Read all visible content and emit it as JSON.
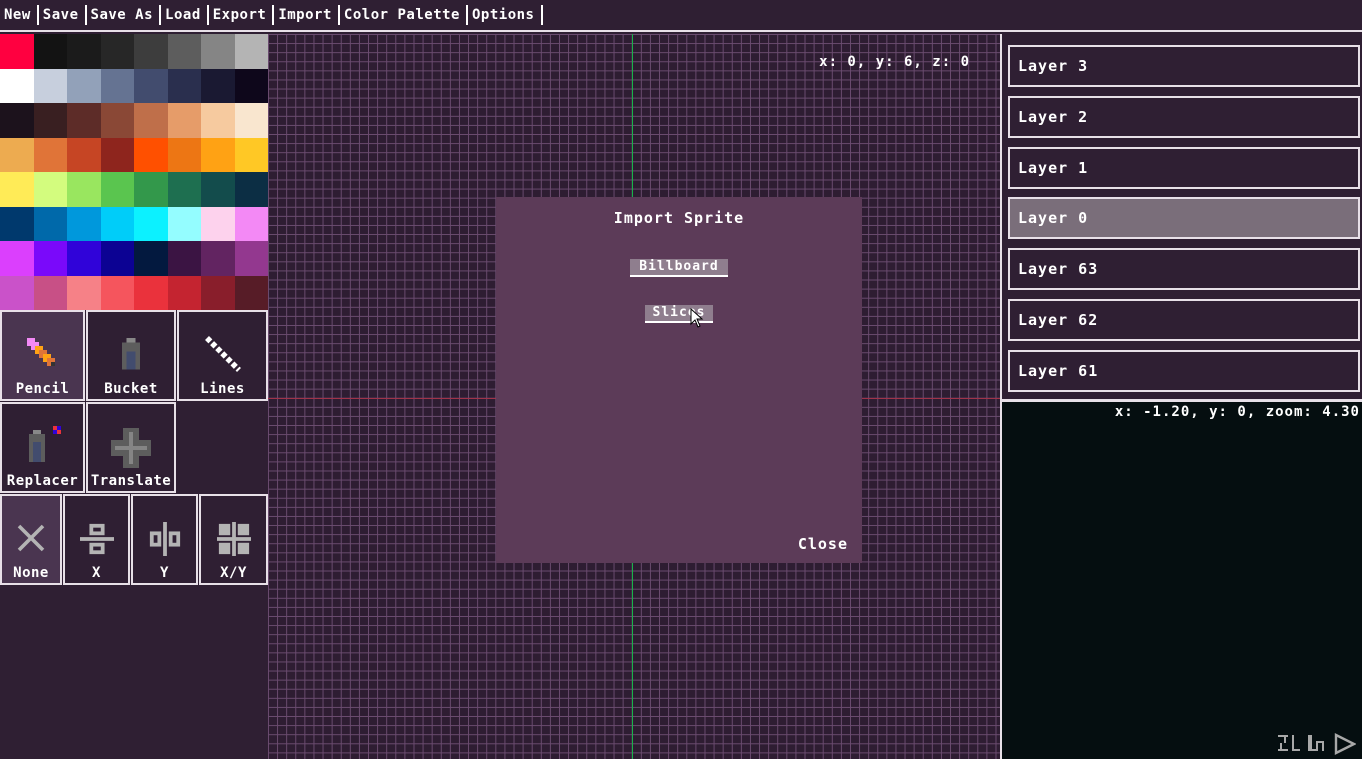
{
  "menu": [
    "New",
    "Save",
    "Save As",
    "Load",
    "Export",
    "Import",
    "Color Palette",
    "Options"
  ],
  "palette": [
    "#ff0040",
    "#131313",
    "#1b1b1b",
    "#272727",
    "#3d3d3d",
    "#5d5d5d",
    "#858585",
    "#b4b4b4",
    "#ffffff",
    "#c7cfdd",
    "#92a1b9",
    "#657392",
    "#424c6e",
    "#2a2f4e",
    "#1a1932",
    "#0e071b",
    "#1c121c",
    "#391f21",
    "#5d2c28",
    "#8a4836",
    "#bf6f4a",
    "#e69c69",
    "#f6ca9f",
    "#f9e6cf",
    "#edab50",
    "#e07438",
    "#c64524",
    "#8e251d",
    "#ff5000",
    "#ed7614",
    "#ffa214",
    "#ffc825",
    "#ffeb57",
    "#d3fc7e",
    "#99e65f",
    "#5ac54f",
    "#33984b",
    "#1e6f50",
    "#134c4c",
    "#0c2e44",
    "#00396d",
    "#0069aa",
    "#0098dc",
    "#00cdf9",
    "#0cf1ff",
    "#94fdff",
    "#fdd2ed",
    "#f389f5",
    "#db3ffd",
    "#7a09fa",
    "#3003d9",
    "#0c0293",
    "#03193f",
    "#3b1443",
    "#622461",
    "#93388f",
    "#ca52c9",
    "#c85086",
    "#f68187",
    "#f5555d",
    "#ea323c",
    "#c42430",
    "#891e2b",
    "#571c27"
  ],
  "tools": {
    "pencil": "Pencil",
    "bucket": "Bucket",
    "lines": "Lines",
    "replacer": "Replacer",
    "translate": "Translate"
  },
  "mirror": {
    "none": "None",
    "x": "X",
    "y": "Y",
    "xy": "X/Y"
  },
  "canvas_coords": "x: 0, y: 6, z: 0",
  "dialog": {
    "title": "Import Sprite",
    "billboard": "Billboard",
    "slices": "Slices",
    "close": "Close"
  },
  "layers": [
    "Layer 3",
    "Layer 2",
    "Layer 1",
    "Layer 0",
    "Layer 63",
    "Layer 62",
    "Layer 61"
  ],
  "active_layer": "Layer 0",
  "preview_coords": "x: -1.20, y: 0, zoom: 4.30",
  "colors": {
    "panel": "#2f1f33",
    "dialog": "#5c3b58",
    "button": "#8f7e8e",
    "active_layer": "#7a6e7a",
    "preview_bg": "#050e10"
  }
}
